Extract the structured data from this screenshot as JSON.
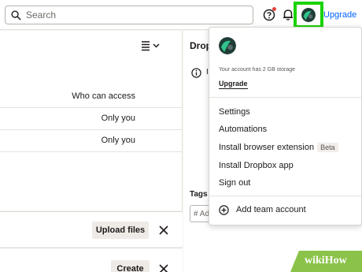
{
  "header": {
    "search_placeholder": "Search",
    "upgrade_label": "Upgrade"
  },
  "left_pane": {
    "column_header": "Who can access",
    "rows": [
      {
        "access": "Only you"
      },
      {
        "access": "Only you"
      }
    ]
  },
  "right_pane": {
    "title_fragment": "Drop",
    "info_fragment": "I",
    "tags_label": "Tags",
    "tags_placeholder": "# Ad"
  },
  "panels": {
    "upload_label": "Upload files",
    "create_label": "Create"
  },
  "account_menu": {
    "storage_text": "Your account has 2 GB storage",
    "upgrade_label": "Upgrade",
    "items": [
      {
        "label": "Settings"
      },
      {
        "label": "Automations"
      },
      {
        "label": "Install browser extension",
        "badge": "Beta"
      },
      {
        "label": "Install Dropbox app"
      },
      {
        "label": "Sign out"
      }
    ],
    "add_team_label": "Add team account"
  },
  "watermark": {
    "text": "wikiHow"
  },
  "colors": {
    "highlight": "#1bd300",
    "link": "#0061fe",
    "notification_dot": "#e8413c",
    "watermark": "#8bc34a"
  },
  "icons": [
    "search-icon",
    "help-icon",
    "bell-icon",
    "avatar",
    "list-view-icon",
    "info-icon",
    "close-icon",
    "plus-circle-icon"
  ]
}
